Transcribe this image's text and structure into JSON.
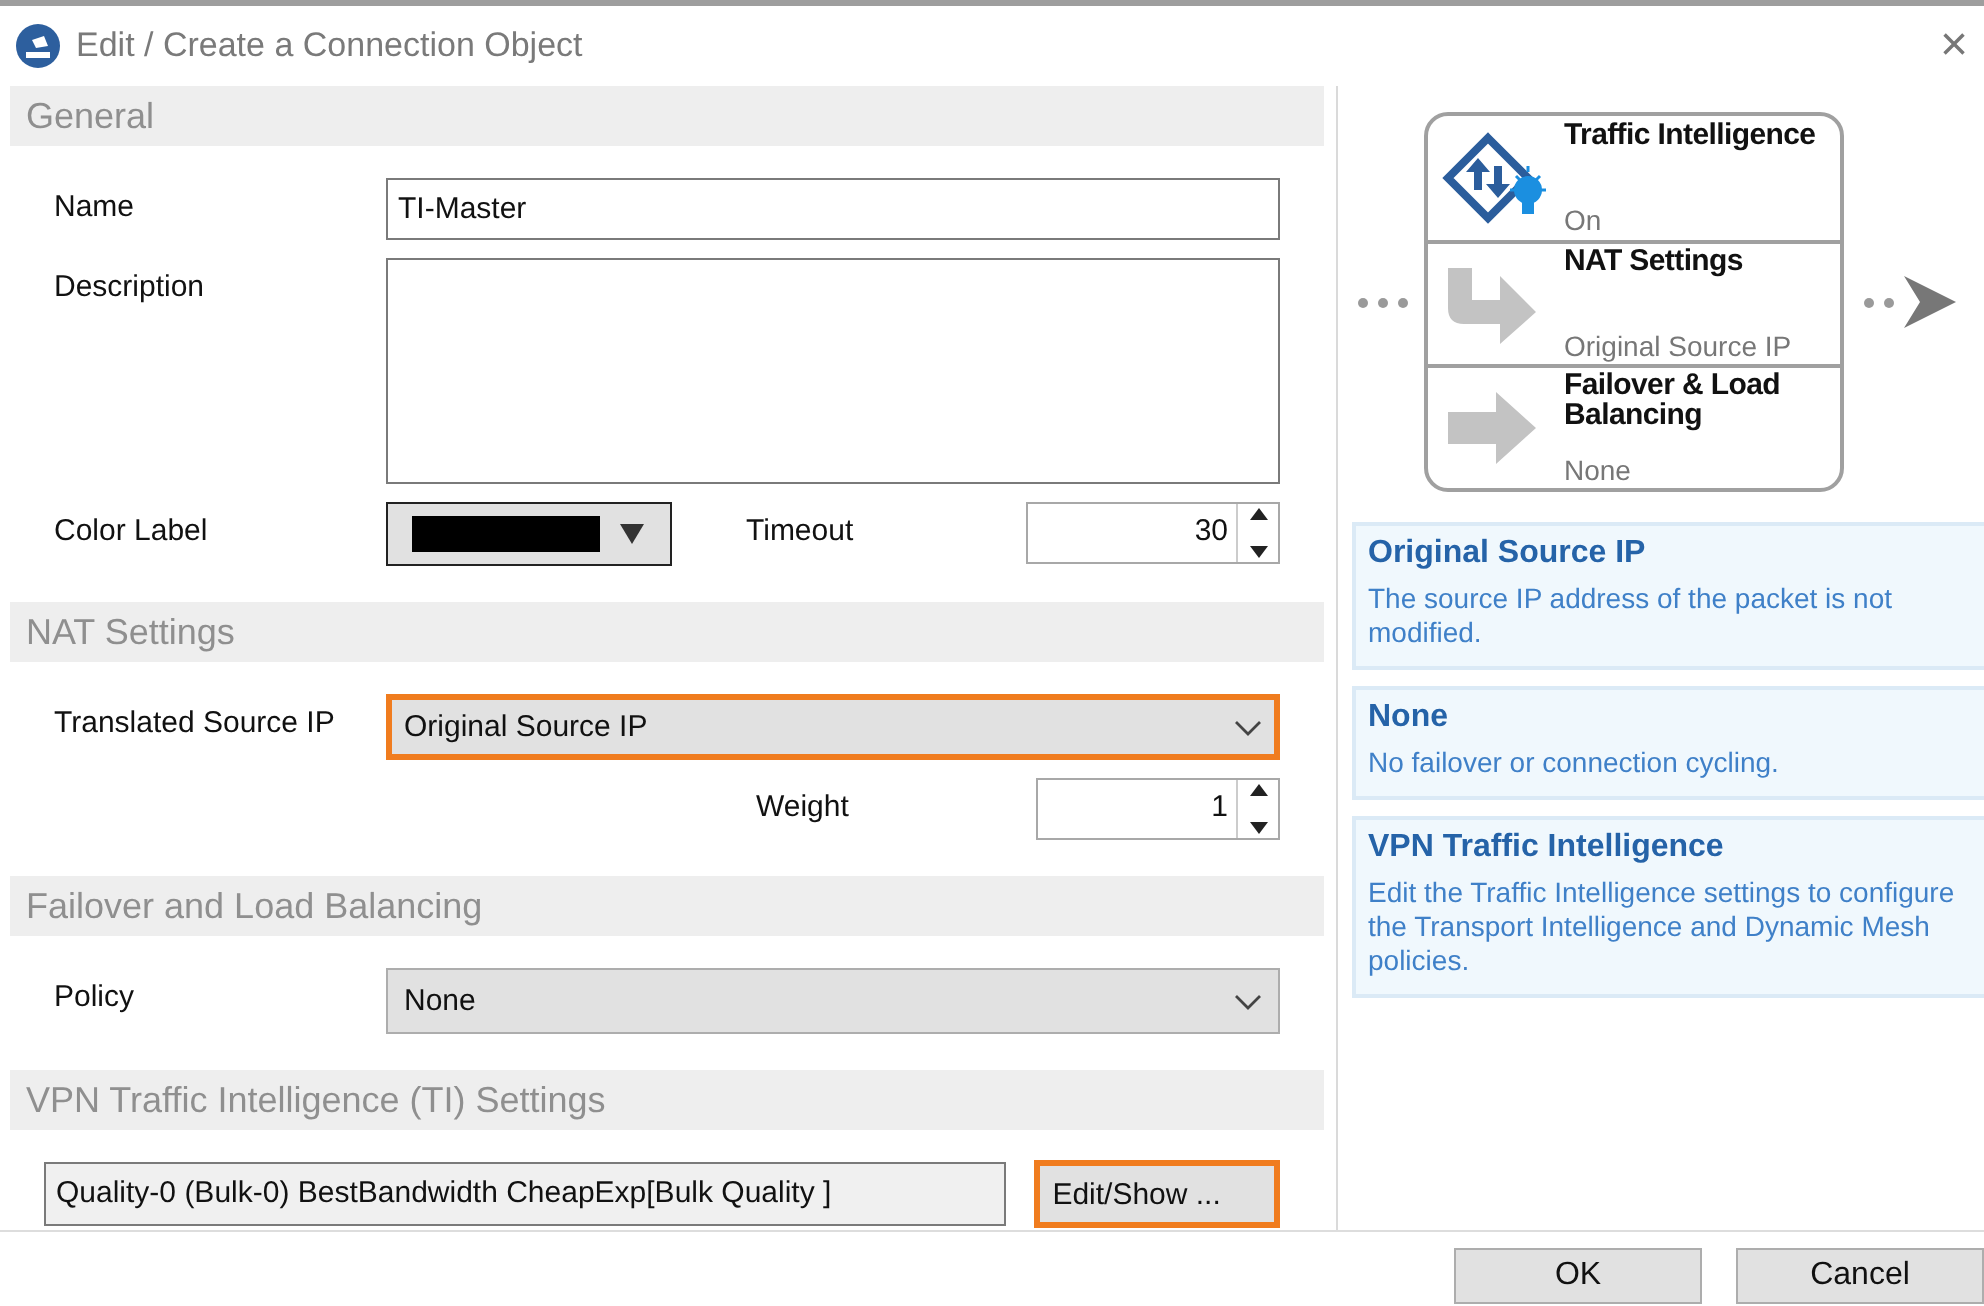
{
  "window": {
    "title": "Edit / Create a Connection Object",
    "close": "×"
  },
  "sections": [
    {
      "title": "General",
      "rows": [
        {
          "kind": "text",
          "label": "Name",
          "value": "TI-Master"
        },
        {
          "kind": "textarea",
          "label": "Description"
        },
        {
          "kind": "color-spin",
          "label": "Color Label",
          "color": "#000000",
          "spin_label": "Timeout",
          "spin_value": "30"
        }
      ]
    },
    {
      "title": "NAT Settings",
      "rows": [
        {
          "kind": "select",
          "label": "Translated Source IP",
          "value": "Original Source IP",
          "highlighted": true
        },
        {
          "kind": "spin",
          "label": "Weight",
          "value": "1"
        }
      ]
    },
    {
      "title": "Failover and Load Balancing",
      "rows": [
        {
          "kind": "select",
          "label": "Policy",
          "value": "None",
          "highlighted": false
        }
      ]
    },
    {
      "title": "VPN Traffic Intelligence (TI) Settings",
      "rows": [
        {
          "kind": "summary",
          "value": "Quality-0 (Bulk-0) BestBandwidth CheapExp[Bulk Quality ]",
          "button": "Edit/Show ...",
          "highlighted": true
        }
      ]
    }
  ],
  "flow": {
    "steps": [
      {
        "kind": "ti",
        "title": "Traffic Intelligence",
        "status": "On"
      },
      {
        "kind": "nat",
        "title": "NAT Settings",
        "status": "Original Source IP"
      },
      {
        "kind": "failover",
        "title": "Failover & Load Balancing",
        "status": "None"
      }
    ]
  },
  "info_cards": [
    {
      "title": "Original Source IP",
      "text": "The source IP address of the packet is not modified."
    },
    {
      "title": "None",
      "text": "No failover or connection cycling."
    },
    {
      "title": "VPN Traffic Intelligence",
      "text": "Edit the Traffic Intelligence settings to configure the Transport Intelligence and Dynamic Mesh policies."
    }
  ],
  "buttons": [
    "OK",
    "Cancel"
  ]
}
